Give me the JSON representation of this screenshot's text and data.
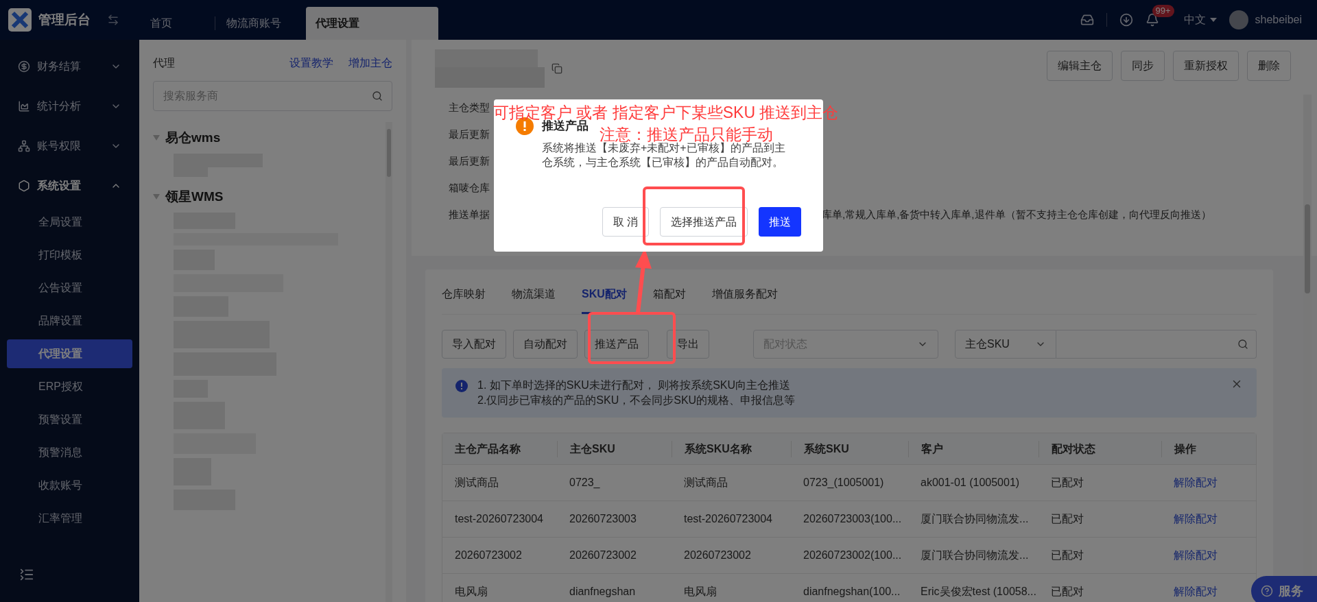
{
  "app": {
    "title": "管理后台"
  },
  "top_tabs": [
    {
      "label": "首页",
      "selected": false
    },
    {
      "label": "物流商账号",
      "selected": false
    },
    {
      "label": "代理设置",
      "selected": true
    }
  ],
  "header_right": {
    "notification_count": "99+",
    "language": "中文",
    "username": "shebeibei"
  },
  "sidebar": {
    "items": [
      {
        "label": "财务结算",
        "expanded": false
      },
      {
        "label": "统计分析",
        "expanded": false
      },
      {
        "label": "账号权限",
        "expanded": false
      },
      {
        "label": "系统设置",
        "expanded": true,
        "children": [
          {
            "label": "全局设置",
            "selected": false
          },
          {
            "label": "打印模板",
            "selected": false
          },
          {
            "label": "公告设置",
            "selected": false
          },
          {
            "label": "品牌设置",
            "selected": false
          },
          {
            "label": "代理设置",
            "selected": true
          },
          {
            "label": "ERP授权",
            "selected": false
          },
          {
            "label": "预警设置",
            "selected": false
          },
          {
            "label": "预警消息",
            "selected": false
          },
          {
            "label": "收款账号",
            "selected": false
          },
          {
            "label": "汇率管理",
            "selected": false
          }
        ]
      }
    ]
  },
  "agent_panel": {
    "title": "代理",
    "links": [
      "设置教学",
      "增加主仓"
    ],
    "search": {
      "placeholder": "搜索服务商"
    },
    "groups": [
      {
        "label": "易仓wms",
        "expanded": true
      },
      {
        "label": "领星WMS",
        "expanded": true
      }
    ]
  },
  "warehouse_card": {
    "buttons": [
      "编辑主仓",
      "同步",
      "重新授权",
      "删除"
    ],
    "fields": [
      {
        "label": "主仓类型"
      },
      {
        "label": "最后更新"
      },
      {
        "label": "最后更新"
      },
      {
        "label": "箱唛仓库"
      },
      {
        "label": "推送单据",
        "value": "库单,常规入库单,备货中转入库单,退件单（暂不支持主仓仓库创建，向代理反向推送）"
      }
    ]
  },
  "tabs": [
    {
      "label": "仓库映射",
      "selected": false
    },
    {
      "label": "物流渠道",
      "selected": false
    },
    {
      "label": "SKU配对",
      "selected": true
    },
    {
      "label": "箱配对",
      "selected": false
    },
    {
      "label": "增值服务配对",
      "selected": false
    }
  ],
  "toolbar": {
    "buttons": [
      "导入配对",
      "自动配对",
      "推送产品",
      "导出"
    ],
    "status_filter": {
      "placeholder": "配对状态"
    },
    "search_type": "主仓SKU"
  },
  "alert": {
    "lines": [
      "1. 如下单时选择的SKU未进行配对， 则将按系统SKU向主仓推送",
      "2.仅同步已审核的产品的SKU，不会同步SKU的规格、申报信息等"
    ]
  },
  "table": {
    "columns": [
      "主仓产品名称",
      "主仓SKU",
      "系统SKU名称",
      "系统SKU",
      "客户",
      "配对状态",
      "操作"
    ],
    "rows": [
      {
        "cells": [
          "测试商品",
          "0723_",
          "测试商品",
          "0723_(1005001)",
          "ak001-01 (1005001)",
          "已配对"
        ],
        "action": "解除配对"
      },
      {
        "cells": [
          "test-20260723004",
          "20260723003",
          "test-20260723004",
          "20260723003(100...",
          "厦门联合协同物流发...",
          "已配对"
        ],
        "action": "解除配对"
      },
      {
        "cells": [
          "20260723002",
          "20260723002",
          "20260723002",
          "20260723002(100...",
          "厦门联合协同物流发...",
          "已配对"
        ],
        "action": "解除配对"
      },
      {
        "cells": [
          "电风扇",
          "dianfnegshan",
          "电风扇",
          "dianfnegshan(100...",
          "Eric吴俊宏test (10058...",
          "已配对"
        ],
        "action": "解除配对"
      }
    ]
  },
  "service_button": "服务",
  "dialog": {
    "title": "推送产品",
    "message": "系统将推送【未废弃+未配对+已审核】的产品到主仓系统，与主仓系统【已审核】的产品自动配对。",
    "buttons": [
      {
        "label": "取 消",
        "kind": "default"
      },
      {
        "label": "选择推送产品",
        "kind": "default"
      },
      {
        "label": "推送",
        "kind": "primary"
      }
    ]
  },
  "annotations": [
    "可指定客户 或者 指定客户下某些SKU 推送到主仓",
    "注意：推送产品只能手动"
  ]
}
